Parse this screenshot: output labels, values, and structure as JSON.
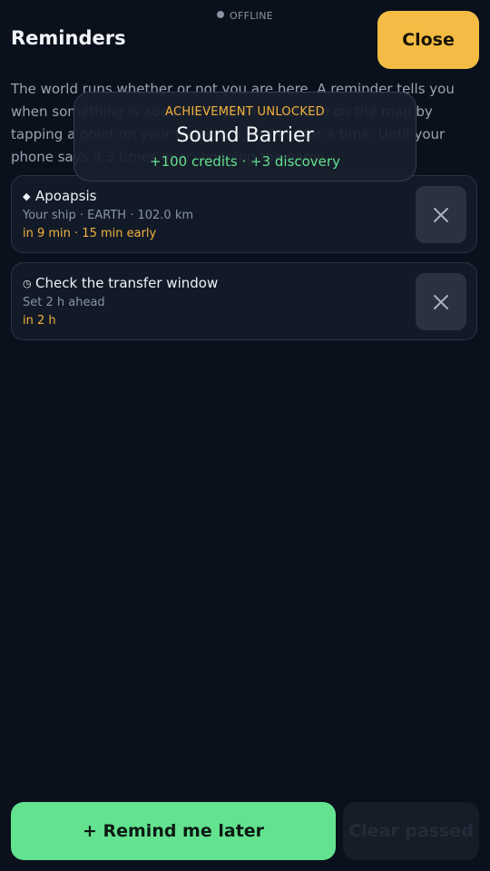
{
  "status": {
    "label": "OFFLINE",
    "dot_color": "#8b94a3"
  },
  "header": {
    "title": "Reminders",
    "close_label": "Close"
  },
  "intro": "The world runs whether or not you are here. A reminder tells you when something is about to happen — set one on the map by tapping a point on your trajectory, or here for a time. Until your phone says it 3 times over; opening the game.",
  "reminders": [
    {
      "glyph": "◆",
      "title": "Apoapsis",
      "subtitle": "Your ship · EARTH · 102.0 km",
      "when": "in 9 min · 15 min early",
      "dismiss_icon": "close-icon"
    },
    {
      "glyph": "◷",
      "title": "Check the transfer window",
      "subtitle": "Set 2 h ahead",
      "when": "in 2 h",
      "dismiss_icon": "close-icon"
    }
  ],
  "toast": {
    "kicker": "ACHIEVEMENT UNLOCKED",
    "title": "Sound Barrier",
    "reward": "+100 credits · +3 discovery"
  },
  "actions": {
    "remind_label": "+ Remind me later",
    "clear_label": "Clear passed"
  },
  "colors": {
    "background": "#0b111c",
    "accent_yellow": "#f4bc44",
    "accent_green": "#63e290",
    "time_orange": "#f4b23c"
  }
}
